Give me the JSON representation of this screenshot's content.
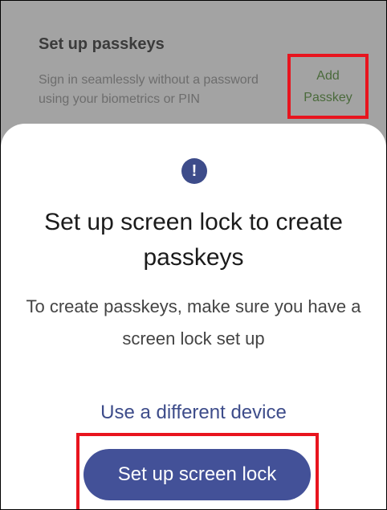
{
  "background_card": {
    "title": "Set up passkeys",
    "description": "Sign in seamlessly without a password using your biometrics or PIN",
    "add_passkey_line1": "Add",
    "add_passkey_line2": "Passkey"
  },
  "dialog": {
    "icon": "!",
    "heading": "Set up screen lock to create passkeys",
    "body": "To create passkeys, make sure you have a screen lock set up",
    "secondary_button": "Use a different device",
    "primary_button": "Set up screen lock"
  },
  "colors": {
    "accent": "#435198",
    "highlight": "#e8141e",
    "scrim": "#a6a6a6"
  },
  "icons": {
    "alert": "exclamation-circle-icon"
  }
}
